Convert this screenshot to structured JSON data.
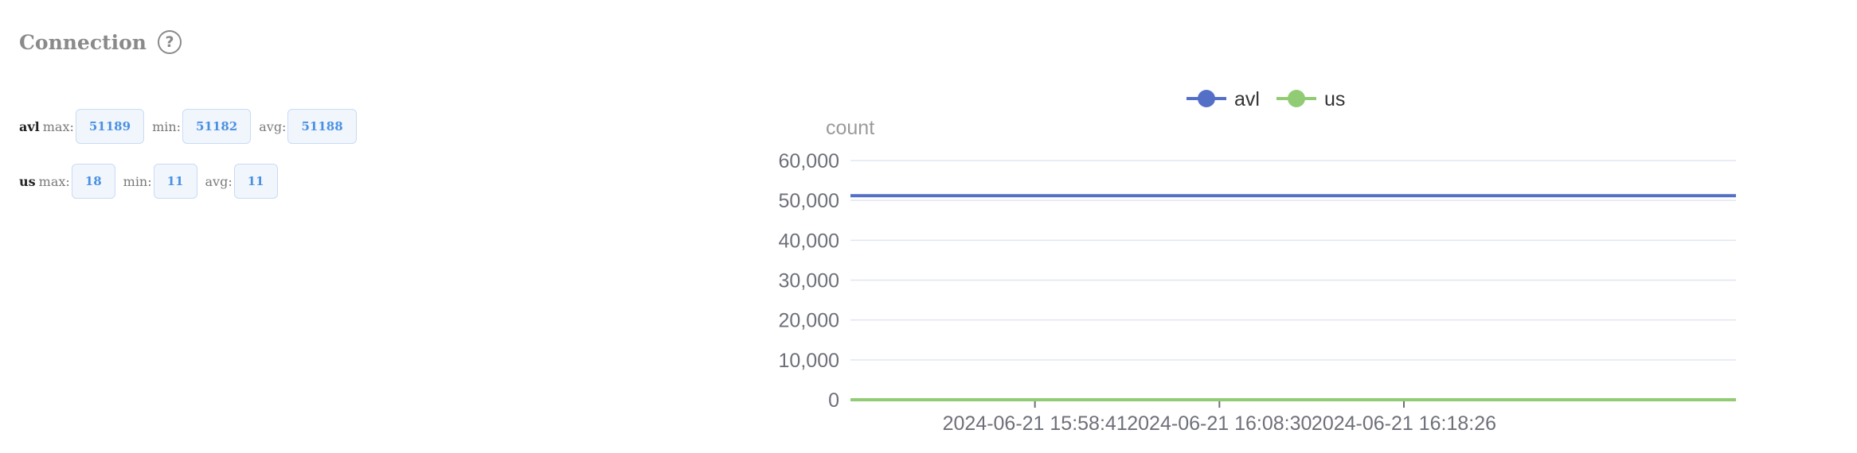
{
  "header": {
    "title": "Connection",
    "help_icon": "question-circle-icon"
  },
  "stats": [
    {
      "name": "avl",
      "max_label": "max:",
      "max": "51189",
      "min_label": "min:",
      "min": "51182",
      "avg_label": "avg:",
      "avg": "51188"
    },
    {
      "name": "us",
      "max_label": "max:",
      "max": "18",
      "min_label": "min:",
      "min": "11",
      "avg_label": "avg:",
      "avg": "11"
    }
  ],
  "colors": {
    "avl": "#5470c6",
    "us": "#91cc75",
    "pill_text": "#4a90e2"
  },
  "chart_data": {
    "type": "line",
    "ylabel": "count",
    "ylim": [
      0,
      60000
    ],
    "yticks": [
      0,
      10000,
      20000,
      30000,
      40000,
      50000,
      60000
    ],
    "ytick_labels": [
      "0",
      "10,000",
      "20,000",
      "30,000",
      "40,000",
      "50,000",
      "60,000"
    ],
    "xtick_labels": [
      "2024-06-21 15:58:41",
      "2024-06-21 16:08:30",
      "2024-06-21 16:18:26"
    ],
    "legend_position": "top-center",
    "grid": true,
    "series": [
      {
        "name": "avl",
        "color": "#5470c6",
        "values": [
          51188,
          51188,
          51188,
          51188,
          51188,
          51188,
          51188
        ]
      },
      {
        "name": "us",
        "color": "#91cc75",
        "values": [
          11,
          11,
          11,
          11,
          11,
          11,
          11
        ]
      }
    ]
  }
}
